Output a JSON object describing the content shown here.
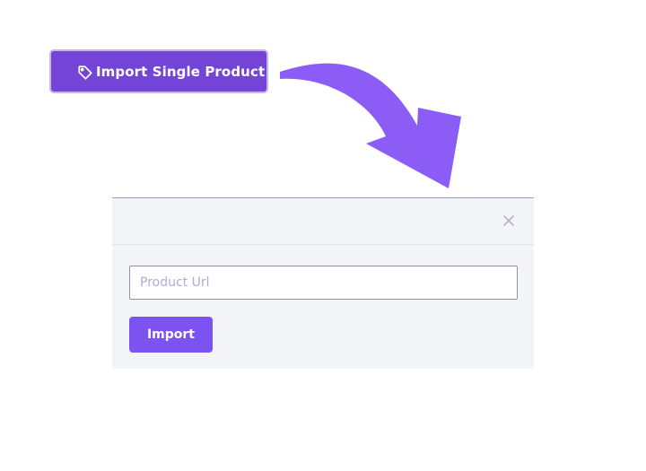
{
  "trigger_button": {
    "label": "Import Single Product",
    "icon": "tag-icon"
  },
  "modal": {
    "close_icon": "close-icon",
    "url_input": {
      "value": "",
      "placeholder": "Product Url"
    },
    "import_button": {
      "label": "Import"
    }
  },
  "colors": {
    "trigger_bg": "#7444d6",
    "arrow": "#8b5cf6",
    "import_bg": "#7c53f0",
    "modal_bg": "#f3f4f8"
  }
}
